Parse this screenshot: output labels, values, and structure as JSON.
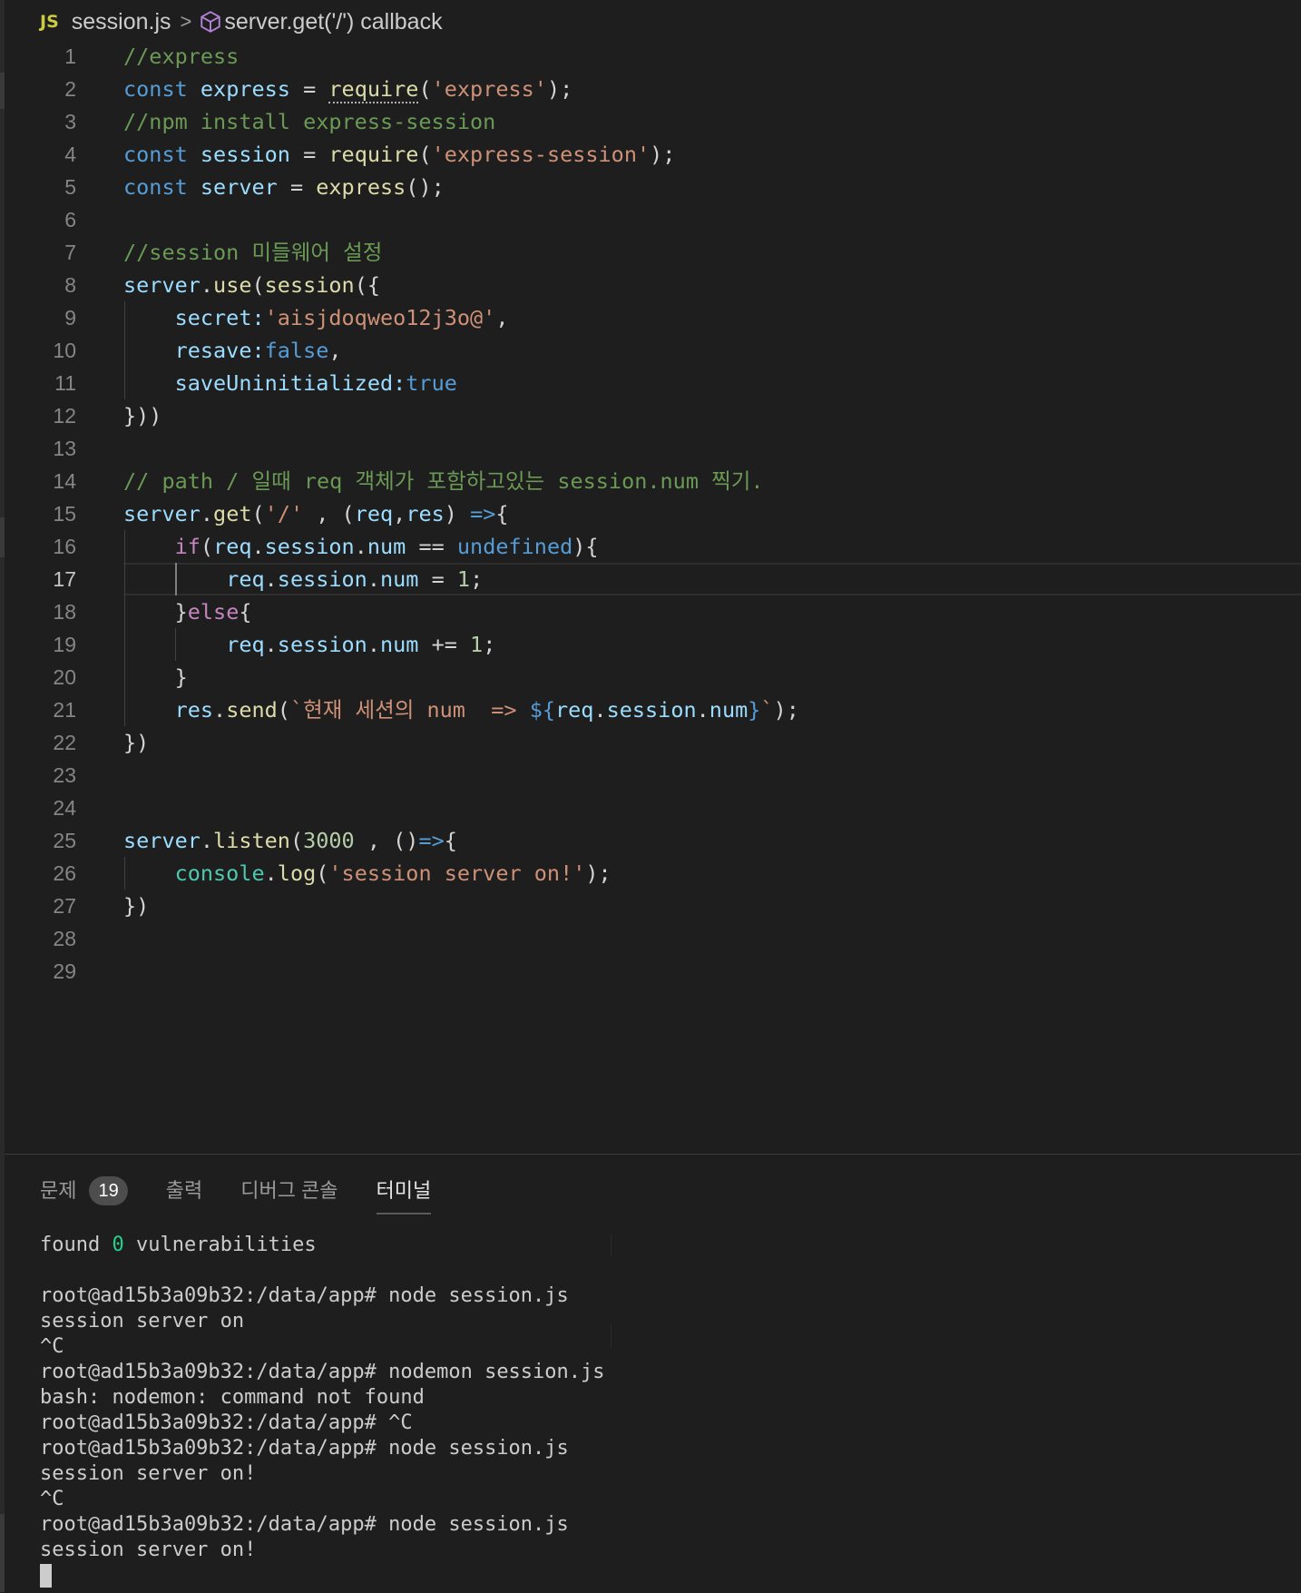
{
  "breadcrumb": {
    "file_icon": "JS",
    "file_name": "session.js",
    "separator": ">",
    "symbol_icon": "cube-symbol-icon",
    "symbol_name": "server.get('/') callback"
  },
  "editor": {
    "current_line": 17,
    "line_numbers": [
      "1",
      "2",
      "3",
      "4",
      "5",
      "6",
      "7",
      "8",
      "9",
      "10",
      "11",
      "12",
      "13",
      "14",
      "15",
      "16",
      "17",
      "18",
      "19",
      "20",
      "21",
      "22",
      "23",
      "24",
      "25",
      "26",
      "27",
      "28",
      "29"
    ],
    "lines": [
      [
        {
          "t": "c",
          "v": "//express"
        }
      ],
      [
        {
          "t": "k",
          "v": "const"
        },
        {
          "t": "p",
          "v": " "
        },
        {
          "t": "v",
          "v": "express"
        },
        {
          "t": "p",
          "v": " = "
        },
        {
          "t": "fs",
          "v": "require"
        },
        {
          "t": "p",
          "v": "("
        },
        {
          "t": "s",
          "v": "'express'"
        },
        {
          "t": "p",
          "v": ");"
        }
      ],
      [
        {
          "t": "c",
          "v": "//npm install express-session"
        }
      ],
      [
        {
          "t": "k",
          "v": "const"
        },
        {
          "t": "p",
          "v": " "
        },
        {
          "t": "v",
          "v": "session"
        },
        {
          "t": "p",
          "v": " = "
        },
        {
          "t": "f",
          "v": "require"
        },
        {
          "t": "p",
          "v": "("
        },
        {
          "t": "s",
          "v": "'express-session'"
        },
        {
          "t": "p",
          "v": ");"
        }
      ],
      [
        {
          "t": "k",
          "v": "const"
        },
        {
          "t": "p",
          "v": " "
        },
        {
          "t": "v",
          "v": "server"
        },
        {
          "t": "p",
          "v": " = "
        },
        {
          "t": "f",
          "v": "express"
        },
        {
          "t": "p",
          "v": "();"
        }
      ],
      [],
      [
        {
          "t": "c",
          "v": "//session 미들웨어 설정"
        }
      ],
      [
        {
          "t": "v",
          "v": "server"
        },
        {
          "t": "p",
          "v": "."
        },
        {
          "t": "f",
          "v": "use"
        },
        {
          "t": "p",
          "v": "("
        },
        {
          "t": "f",
          "v": "session"
        },
        {
          "t": "p",
          "v": "({"
        }
      ],
      [
        {
          "t": "p",
          "v": "    "
        },
        {
          "t": "v",
          "v": "secret"
        },
        {
          "t": "v",
          "v": ":"
        },
        {
          "t": "s",
          "v": "'aisjdoqweo12j3o@'"
        },
        {
          "t": "p",
          "v": ","
        }
      ],
      [
        {
          "t": "p",
          "v": "    "
        },
        {
          "t": "v",
          "v": "resave"
        },
        {
          "t": "v",
          "v": ":"
        },
        {
          "t": "k",
          "v": "false"
        },
        {
          "t": "p",
          "v": ","
        }
      ],
      [
        {
          "t": "p",
          "v": "    "
        },
        {
          "t": "v",
          "v": "saveUninitialized"
        },
        {
          "t": "v",
          "v": ":"
        },
        {
          "t": "k",
          "v": "true"
        }
      ],
      [
        {
          "t": "p",
          "v": "}))"
        }
      ],
      [],
      [
        {
          "t": "c",
          "v": "// path / 일때 req 객체가 포함하고있는 session.num 찍기."
        }
      ],
      [
        {
          "t": "v",
          "v": "server"
        },
        {
          "t": "p",
          "v": "."
        },
        {
          "t": "f",
          "v": "get"
        },
        {
          "t": "p",
          "v": "("
        },
        {
          "t": "s",
          "v": "'/'"
        },
        {
          "t": "p",
          "v": " , ("
        },
        {
          "t": "v",
          "v": "req"
        },
        {
          "t": "p",
          "v": ","
        },
        {
          "t": "v",
          "v": "res"
        },
        {
          "t": "p",
          "v": ") "
        },
        {
          "t": "k",
          "v": "=>"
        },
        {
          "t": "p",
          "v": "{"
        }
      ],
      [
        {
          "t": "p",
          "v": "    "
        },
        {
          "t": "x",
          "v": "if"
        },
        {
          "t": "p",
          "v": "("
        },
        {
          "t": "v",
          "v": "req"
        },
        {
          "t": "p",
          "v": "."
        },
        {
          "t": "v",
          "v": "session"
        },
        {
          "t": "p",
          "v": "."
        },
        {
          "t": "v",
          "v": "num"
        },
        {
          "t": "p",
          "v": " == "
        },
        {
          "t": "k",
          "v": "undefined"
        },
        {
          "t": "p",
          "v": "){"
        }
      ],
      [
        {
          "t": "p",
          "v": "        "
        },
        {
          "t": "v",
          "v": "req"
        },
        {
          "t": "p",
          "v": "."
        },
        {
          "t": "v",
          "v": "session"
        },
        {
          "t": "p",
          "v": "."
        },
        {
          "t": "v",
          "v": "num"
        },
        {
          "t": "p",
          "v": " = "
        },
        {
          "t": "n",
          "v": "1"
        },
        {
          "t": "p",
          "v": ";"
        }
      ],
      [
        {
          "t": "p",
          "v": "    }"
        },
        {
          "t": "x",
          "v": "else"
        },
        {
          "t": "p",
          "v": "{"
        }
      ],
      [
        {
          "t": "p",
          "v": "        "
        },
        {
          "t": "v",
          "v": "req"
        },
        {
          "t": "p",
          "v": "."
        },
        {
          "t": "v",
          "v": "session"
        },
        {
          "t": "p",
          "v": "."
        },
        {
          "t": "v",
          "v": "num"
        },
        {
          "t": "p",
          "v": " += "
        },
        {
          "t": "n",
          "v": "1"
        },
        {
          "t": "p",
          "v": ";"
        }
      ],
      [
        {
          "t": "p",
          "v": "    }"
        }
      ],
      [
        {
          "t": "p",
          "v": "    "
        },
        {
          "t": "v",
          "v": "res"
        },
        {
          "t": "p",
          "v": "."
        },
        {
          "t": "f",
          "v": "send"
        },
        {
          "t": "p",
          "v": "("
        },
        {
          "t": "s",
          "v": "`현재 세션의 num  => "
        },
        {
          "t": "k",
          "v": "${"
        },
        {
          "t": "v",
          "v": "req"
        },
        {
          "t": "p",
          "v": "."
        },
        {
          "t": "v",
          "v": "session"
        },
        {
          "t": "p",
          "v": "."
        },
        {
          "t": "v",
          "v": "num"
        },
        {
          "t": "k",
          "v": "}"
        },
        {
          "t": "s",
          "v": "`"
        },
        {
          "t": "p",
          "v": ");"
        }
      ],
      [
        {
          "t": "p",
          "v": "})"
        }
      ],
      [],
      [],
      [
        {
          "t": "v",
          "v": "server"
        },
        {
          "t": "p",
          "v": "."
        },
        {
          "t": "f",
          "v": "listen"
        },
        {
          "t": "p",
          "v": "("
        },
        {
          "t": "n",
          "v": "3000"
        },
        {
          "t": "p",
          "v": " , ()"
        },
        {
          "t": "k",
          "v": "=>"
        },
        {
          "t": "p",
          "v": "{"
        }
      ],
      [
        {
          "t": "p",
          "v": "    "
        },
        {
          "t": "o",
          "v": "console"
        },
        {
          "t": "p",
          "v": "."
        },
        {
          "t": "f",
          "v": "log"
        },
        {
          "t": "p",
          "v": "("
        },
        {
          "t": "s",
          "v": "'session server on!'"
        },
        {
          "t": "p",
          "v": ");"
        }
      ],
      [
        {
          "t": "p",
          "v": "})"
        }
      ],
      [],
      []
    ]
  },
  "panel": {
    "tabs": [
      {
        "label": "문제",
        "badge": "19"
      },
      {
        "label": "출력"
      },
      {
        "label": "디버그 콘솔"
      },
      {
        "label": "터미널",
        "active": true
      }
    ],
    "terminal": {
      "lines": [
        [
          {
            "t": "p",
            "v": "found "
          },
          {
            "t": "g",
            "v": "0"
          },
          {
            "t": "p",
            "v": " vulnerabilities"
          }
        ],
        [],
        [
          {
            "t": "p",
            "v": "root@ad15b3a09b32:/data/app# node session.js"
          }
        ],
        [
          {
            "t": "p",
            "v": "session server on"
          }
        ],
        [
          {
            "t": "p",
            "v": "^C"
          }
        ],
        [
          {
            "t": "p",
            "v": "root@ad15b3a09b32:/data/app# nodemon session.js"
          }
        ],
        [
          {
            "t": "p",
            "v": "bash: nodemon: command not found"
          }
        ],
        [
          {
            "t": "p",
            "v": "root@ad15b3a09b32:/data/app# ^C"
          }
        ],
        [
          {
            "t": "p",
            "v": "root@ad15b3a09b32:/data/app# node session.js"
          }
        ],
        [
          {
            "t": "p",
            "v": "session server on!"
          }
        ],
        [
          {
            "t": "p",
            "v": "^C"
          }
        ],
        [
          {
            "t": "p",
            "v": "root@ad15b3a09b32:/data/app# node session.js"
          }
        ],
        [
          {
            "t": "p",
            "v": "session server on!"
          }
        ]
      ]
    }
  },
  "colors": {
    "background": "#1e1e1e",
    "comment": "#6a9955",
    "keyword": "#569cd6",
    "control": "#c586c0",
    "variable": "#9cdcfe",
    "function": "#dcdcaa",
    "string": "#ce9178",
    "number": "#b5cea8",
    "terminal_highlight": "#23d18b"
  }
}
